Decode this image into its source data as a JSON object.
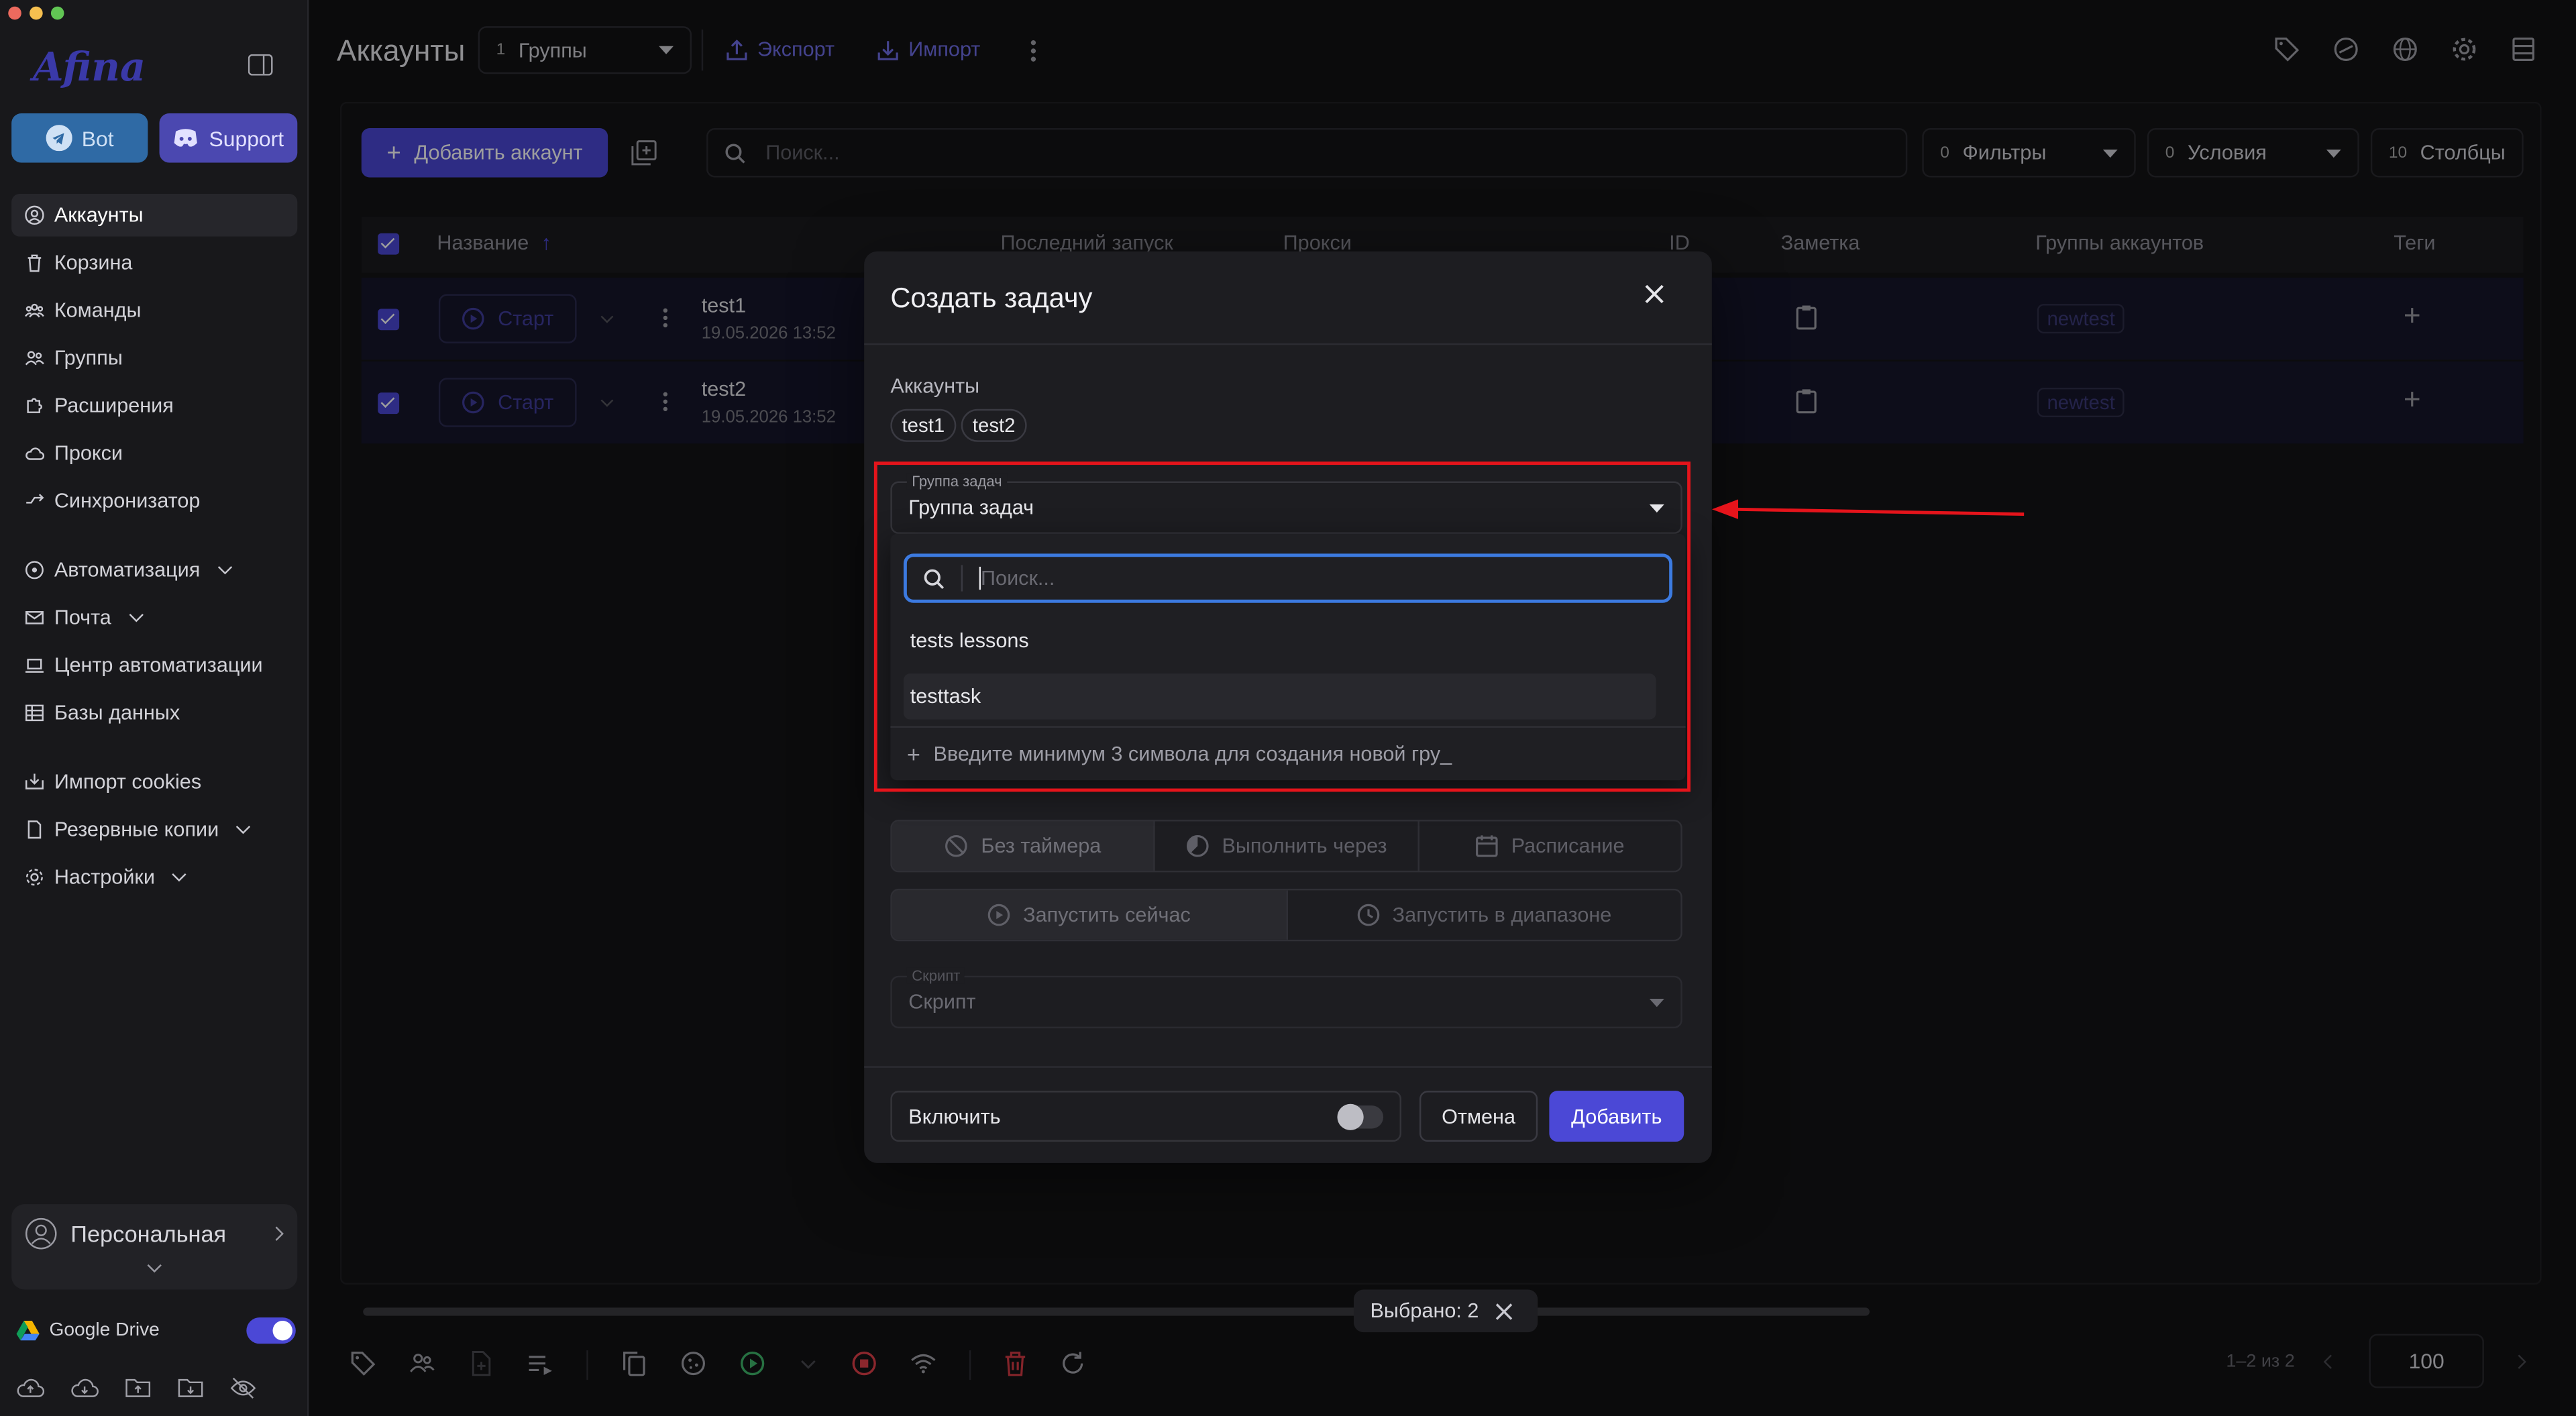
{
  "sidebar": {
    "logo": "Afina",
    "bot_label": "Bot",
    "support_label": "Support",
    "items": [
      {
        "label": "Аккаунты"
      },
      {
        "label": "Корзина"
      },
      {
        "label": "Команды"
      },
      {
        "label": "Группы"
      },
      {
        "label": "Расширения"
      },
      {
        "label": "Прокси"
      },
      {
        "label": "Синхронизатор"
      },
      {
        "label": "Автоматизация"
      },
      {
        "label": "Почта"
      },
      {
        "label": "Центр автоматизации"
      },
      {
        "label": "Базы данных"
      },
      {
        "label": "Импорт cookies"
      },
      {
        "label": "Резервные копии"
      },
      {
        "label": "Настройки"
      }
    ],
    "profile": "Персональная",
    "gdrive": "Google Drive"
  },
  "header": {
    "title": "Аккаунты",
    "groups_count": "1",
    "groups_label": "Группы",
    "export_label": "Экспорт",
    "import_label": "Импорт"
  },
  "toolbar": {
    "add_account": "Добавить аккаунт",
    "search_placeholder": "Поиск...",
    "filters_count": "0",
    "filters_label": "Фильтры",
    "conditions_count": "0",
    "conditions_label": "Условия",
    "columns_count": "10",
    "columns_label": "Столбцы"
  },
  "table": {
    "columns": [
      "Название",
      "Последний запуск",
      "Прокси",
      "ID",
      "Заметка",
      "Группы аккаунтов",
      "Теги"
    ],
    "rows": [
      {
        "start": "Старт",
        "name": "test1",
        "date": "19.05.2026 13:52",
        "group": "newtest"
      },
      {
        "start": "Старт",
        "name": "test2",
        "date": "19.05.2026 13:52",
        "group": "newtest"
      }
    ]
  },
  "bottom": {
    "selected": "Выбрано: 2",
    "pager": "1–2 из 2",
    "page_size": "100"
  },
  "modal": {
    "title": "Создать задачу",
    "accounts_label": "Аккаунты",
    "accounts": [
      "test1",
      "test2"
    ],
    "task_group_label": "Группа задач",
    "task_group_value": "Группа задач",
    "timer_options": [
      "Без таймера",
      "Выполнить через",
      "Расписание"
    ],
    "run_options": [
      "Запустить сейчас",
      "Запустить в диапазоне"
    ],
    "script_label": "Скрипт",
    "script_value": "Скрипт",
    "enable_label": "Включить",
    "cancel_label": "Отмена",
    "add_label": "Добавить"
  },
  "dropdown": {
    "search_placeholder": "Поиск...",
    "options": [
      "tests lessons",
      "testtask"
    ],
    "create_hint": "Введите минимум 3 символа для создания новой гру_"
  },
  "colors": {
    "accent": "#4b48d6",
    "link": "#6e6ce6",
    "annotation": "#e5141b",
    "focus": "#3c7ae0"
  }
}
